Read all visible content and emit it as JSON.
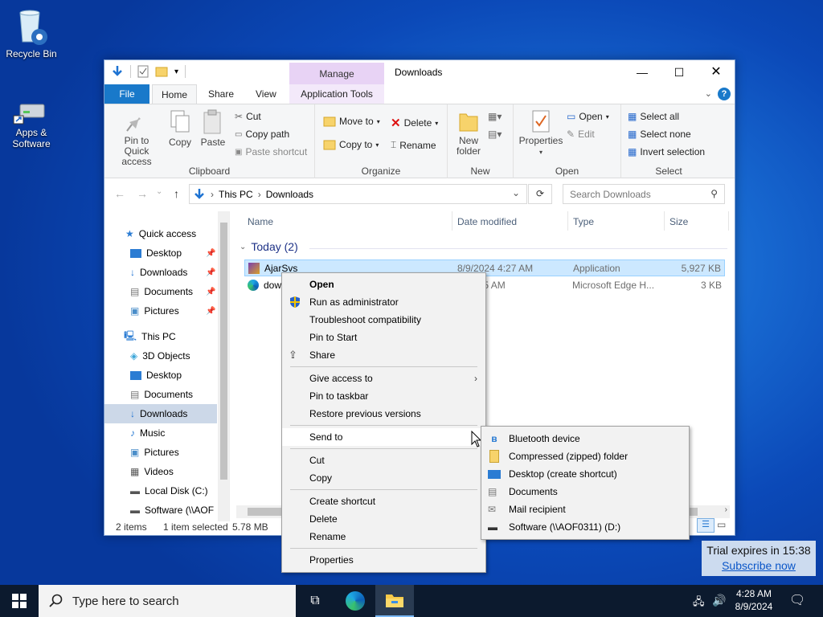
{
  "desktop": {
    "icons": [
      {
        "label": "Recycle Bin",
        "icon": "recycle-bin-icon"
      },
      {
        "label": "Apps & Software",
        "icon": "drive-shortcut-icon"
      }
    ]
  },
  "window": {
    "title": "Downloads",
    "context_tab": "Manage",
    "tabs": [
      "File",
      "Home",
      "Share",
      "View",
      "Application Tools"
    ],
    "help": "?"
  },
  "ribbon": {
    "clipboard": {
      "label": "Clipboard",
      "pin_quick_access": "Pin to Quick access",
      "copy": "Copy",
      "paste": "Paste",
      "cut": "Cut",
      "copy_path": "Copy path",
      "paste_shortcut": "Paste shortcut"
    },
    "organize": {
      "label": "Organize",
      "move_to": "Move to",
      "copy_to": "Copy to",
      "delete": "Delete",
      "rename": "Rename"
    },
    "new": {
      "label": "New",
      "new_folder": "New folder"
    },
    "open": {
      "label": "Open",
      "properties": "Properties",
      "open": "Open",
      "edit": "Edit"
    },
    "select": {
      "label": "Select",
      "select_all": "Select all",
      "select_none": "Select none",
      "invert_selection": "Invert selection"
    }
  },
  "address": {
    "crumbs": [
      "This PC",
      "Downloads"
    ],
    "search_placeholder": "Search Downloads"
  },
  "navpane": {
    "quick_access": "Quick access",
    "quick_items": [
      "Desktop",
      "Downloads",
      "Documents",
      "Pictures"
    ],
    "this_pc": "This PC",
    "pc_items": [
      "3D Objects",
      "Desktop",
      "Documents",
      "Downloads",
      "Music",
      "Pictures",
      "Videos",
      "Local Disk (C:)",
      "Software (\\\\AOF"
    ]
  },
  "columns": [
    "Name",
    "Date modified",
    "Type",
    "Size"
  ],
  "group": "Today (2)",
  "files": [
    {
      "name": "AjarSvs",
      "date": "8/9/2024 4:27 AM",
      "type": "Application",
      "size": "5,927 KB"
    },
    {
      "name": "dow",
      "date": "24 4:25 AM",
      "type": "Microsoft Edge H...",
      "size": "3 KB"
    }
  ],
  "status": {
    "items": "2 items",
    "selected": "1 item selected",
    "size": "5.78 MB"
  },
  "context_menu": {
    "items": [
      "Open",
      "Run as administrator",
      "Troubleshoot compatibility",
      "Pin to Start",
      "Share",
      "Give access to",
      "Pin to taskbar",
      "Restore previous versions",
      "Send to",
      "Cut",
      "Copy",
      "Create shortcut",
      "Delete",
      "Rename",
      "Properties"
    ]
  },
  "send_to_menu": {
    "items": [
      "Bluetooth device",
      "Compressed (zipped) folder",
      "Desktop (create shortcut)",
      "Documents",
      "Mail recipient",
      "Software (\\\\AOF0311) (D:)"
    ]
  },
  "taskbar": {
    "search_placeholder": "Type here to search",
    "time": "4:28 AM",
    "date": "8/9/2024"
  },
  "trial": {
    "text": "Trial expires in 15:38",
    "link": "Subscribe now"
  }
}
